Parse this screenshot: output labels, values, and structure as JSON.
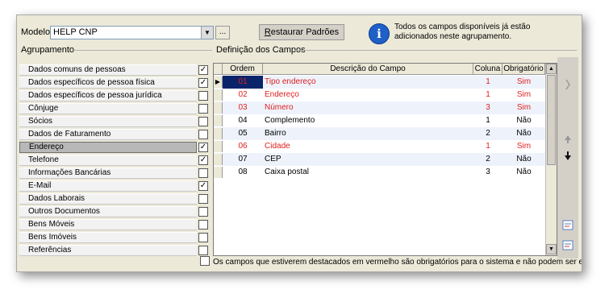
{
  "model": {
    "label": "Modelo:",
    "value": "HELP CNP",
    "browse_label": "..."
  },
  "restore_button": {
    "label_underlined": "R",
    "label_rest": "estaurar Padrões"
  },
  "info_message": "Todos os campos disponíveis já estão adicionados neste agrupamento.",
  "section_labels": {
    "groups": "Agrupamento",
    "fields": "Definição dos Campos"
  },
  "groups": [
    {
      "label": "Dados comuns de pessoas",
      "checked": "✓"
    },
    {
      "label": "Dados específicos de pessoa física",
      "checked": "✓"
    },
    {
      "label": "Dados específicos de pessoa jurídica",
      "checked": ""
    },
    {
      "label": "Cônjuge",
      "checked": ""
    },
    {
      "label": "Sócios",
      "checked": ""
    },
    {
      "label": "Dados de Faturamento",
      "checked": ""
    },
    {
      "label": "Endereço",
      "checked": "✓",
      "selected": true
    },
    {
      "label": "Telefone",
      "checked": "✓"
    },
    {
      "label": "Informações Bancárias",
      "checked": ""
    },
    {
      "label": "E-Mail",
      "checked": "✓"
    },
    {
      "label": "Dados Laborais",
      "checked": ""
    },
    {
      "label": "Outros Documentos",
      "checked": ""
    },
    {
      "label": "Bens Móveis",
      "checked": ""
    },
    {
      "label": "Bens Imóveis",
      "checked": ""
    },
    {
      "label": "Referências",
      "checked": ""
    }
  ],
  "table": {
    "columns": [
      "Ordem",
      "Descrição do Campo",
      "Coluna",
      "Obrigatório"
    ],
    "rows": [
      {
        "ordem": "01",
        "descricao": "Tipo endereço",
        "coluna": "1",
        "obrigatorio": "Sim",
        "required": true,
        "selected": true
      },
      {
        "ordem": "02",
        "descricao": "Endereço",
        "coluna": "1",
        "obrigatorio": "Sim",
        "required": true
      },
      {
        "ordem": "03",
        "descricao": "Número",
        "coluna": "3",
        "obrigatorio": "Sim",
        "required": true
      },
      {
        "ordem": "04",
        "descricao": "Complemento",
        "coluna": "1",
        "obrigatorio": "Não",
        "required": false
      },
      {
        "ordem": "05",
        "descricao": "Bairro",
        "coluna": "2",
        "obrigatorio": "Não",
        "required": false
      },
      {
        "ordem": "06",
        "descricao": "Cidade",
        "coluna": "1",
        "obrigatorio": "Sim",
        "required": true
      },
      {
        "ordem": "07",
        "descricao": "CEP",
        "coluna": "2",
        "obrigatorio": "Não",
        "required": false
      },
      {
        "ordem": "08",
        "descricao": "Caixa postal",
        "coluna": "3",
        "obrigatorio": "Não",
        "required": false
      }
    ]
  },
  "footer_note": "Os campos que estiverem destacados em vermelho são obrigatórios para o sistema e não podem ser excluídos.",
  "colors": {
    "required_text": "#e02020",
    "selection_bg": "#0a246a",
    "info_icon": "#1f5fc8"
  },
  "icons": {
    "move_right": "chevron-right-icon",
    "move_up": "arrow-up-icon",
    "move_down": "arrow-down-icon",
    "edit_1": "edit-form-icon",
    "edit_2": "edit-form-icon"
  }
}
